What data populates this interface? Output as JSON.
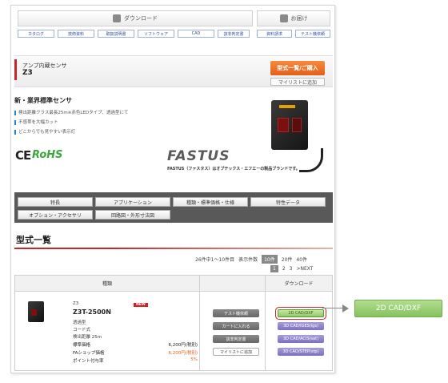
{
  "header": {
    "download_label": "ダウンロード",
    "inquiry_label": "お届け",
    "download_tabs": [
      "カタログ",
      "技術資料",
      "取扱説明書",
      "ソフトウェア",
      "CAD",
      "該非判定書"
    ],
    "inquiry_tabs": [
      "資料請求",
      "テスト機依頼"
    ]
  },
  "product": {
    "subtitle": "アンプ内蔵センサ",
    "name": "Z3",
    "buy_button": "型式一覧/ご購入",
    "mylist_button": "マイリストに追加",
    "headline": "新・業界標準センサ",
    "features": [
      "検出距離クラス最長25m※赤色LEDタイプ、透過型にて",
      "不感帯を大幅カット",
      "どこからでも見やすい表示灯"
    ],
    "ce_mark": "CE",
    "rohs_mark": "RoHS",
    "brand_logo": "FASTUS",
    "brand_note": "FASTUS（ファスタス）はオプテックス・エフエーの製品ブランドです。"
  },
  "nav": {
    "items": [
      "特長",
      "アプリケーション",
      "種類・標準価格・仕様",
      "特性データ",
      "オプション・アクセサリ",
      "回路図・外形寸法図"
    ]
  },
  "list": {
    "title": "型式一覧",
    "result_range": "26件中1～10件目",
    "per_page_label": "表示件数",
    "per_page_options": [
      "10件",
      "20件",
      "40件"
    ],
    "pages": [
      "1",
      "2",
      "3"
    ],
    "next_label": ">NEXT",
    "col_type": "種類",
    "col_download": "ダウンロード"
  },
  "item": {
    "series": "Z3",
    "badge": "NEW",
    "model": "Z3T-2500N",
    "type": "透過型",
    "cable": "コード式",
    "distance": "検出距離 25m",
    "std_price_label": "標準価格",
    "std_price": "6,200円(税別)",
    "shop_price_label": "FAショップ価格",
    "shop_price": "6,200円(税別)",
    "points_label": "ポイント付与率",
    "points": "5%",
    "actions": [
      "テスト機依頼",
      "カートに入れる",
      "該非判定書",
      "マイリストに追加"
    ],
    "downloads": [
      "2D CAD/DXF",
      "3D CAD/IGES(igs)",
      "3D CAD/ACIS(sat)",
      "3D CAD/STEP(stp)"
    ]
  },
  "callout": {
    "label": "2D CAD/DXF"
  }
}
